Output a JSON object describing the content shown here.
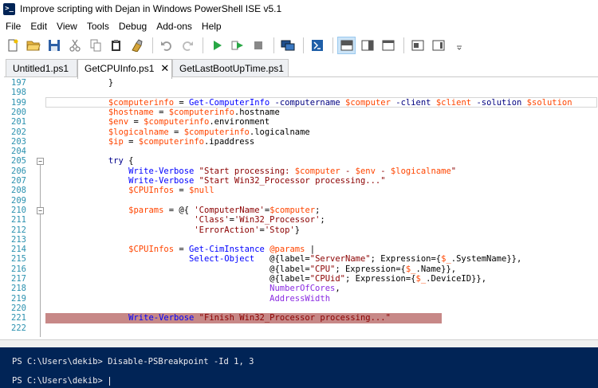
{
  "window": {
    "title": "Improve scripting with Dejan in Windows PowerShell ISE v5.1"
  },
  "menu": [
    "File",
    "Edit",
    "View",
    "Tools",
    "Debug",
    "Add-ons",
    "Help"
  ],
  "toolbar": {
    "icons": [
      "new-file-icon",
      "open-folder-icon",
      "save-icon",
      "cut-icon",
      "copy-icon",
      "paste-icon",
      "clear-icon",
      "undo-icon",
      "redo-icon",
      "run-script-icon",
      "run-selection-icon",
      "stop-icon",
      "new-remote-tab-icon",
      "start-powershell-icon",
      "show-script-pane-top-icon",
      "show-script-pane-right-icon",
      "show-script-pane-maximized-icon",
      "show-command-window-icon",
      "show-command-addon-icon"
    ]
  },
  "tabs": [
    {
      "label": "Untitled1.ps1",
      "active": false
    },
    {
      "label": "GetCPUInfo.ps1",
      "active": true,
      "close": "✕"
    },
    {
      "label": "GetLastBootUpTime.ps1",
      "active": false
    }
  ],
  "editor": {
    "lines": [
      {
        "n": "197",
        "text": "            }"
      },
      {
        "n": "198",
        "text": ""
      },
      {
        "n": "199",
        "text": "            $computerinfo = Get-ComputerInfo -computername $computer -client $client -solution $solution"
      },
      {
        "n": "200",
        "text": "            $hostname = $computerinfo.hostname"
      },
      {
        "n": "201",
        "text": "            $env = $computerinfo.environment"
      },
      {
        "n": "202",
        "text": "            $logicalname = $computerinfo.logicalname"
      },
      {
        "n": "203",
        "text": "            $ip = $computerinfo.ipaddress"
      },
      {
        "n": "204",
        "text": ""
      },
      {
        "n": "205",
        "text": "            try {"
      },
      {
        "n": "206",
        "text": "                Write-Verbose \"Start processing: $computer - $env - $logicalname\""
      },
      {
        "n": "207",
        "text": "                Write-Verbose \"Start Win32_Processor processing...\""
      },
      {
        "n": "208",
        "text": "                $CPUInfos = $null"
      },
      {
        "n": "209",
        "text": ""
      },
      {
        "n": "210",
        "text": "                $params = @{ 'ComputerName'=$computer;"
      },
      {
        "n": "211",
        "text": "                             'Class'='Win32_Processor';"
      },
      {
        "n": "212",
        "text": "                             'ErrorAction'='Stop'}"
      },
      {
        "n": "213",
        "text": ""
      },
      {
        "n": "214",
        "text": "                $CPUInfos = Get-CimInstance @params |"
      },
      {
        "n": "215",
        "text": "                            Select-Object   @{label=\"ServerName\"; Expression={$_.SystemName}},"
      },
      {
        "n": "216",
        "text": "                                            @{label=\"CPU\"; Expression={$_.Name}},"
      },
      {
        "n": "217",
        "text": "                                            @{label=\"CPUid\"; Expression={$_.DeviceID}},"
      },
      {
        "n": "218",
        "text": "                                            NumberOfCores,"
      },
      {
        "n": "219",
        "text": "                                            AddressWidth"
      },
      {
        "n": "220",
        "text": ""
      },
      {
        "n": "221",
        "text": "                Write-Verbose \"Finish Win32_Processor processing...\""
      },
      {
        "n": "222",
        "text": ""
      }
    ]
  },
  "console": {
    "history": "PS C:\\Users\\dekib> Disable-PSBreakpoint -Id 1, 3",
    "prompt": "PS C:\\Users\\dekib> "
  },
  "colors": {
    "console_bg": "#012456",
    "breakpoint_bg": "#c78887",
    "line_number": "#2b91af"
  }
}
